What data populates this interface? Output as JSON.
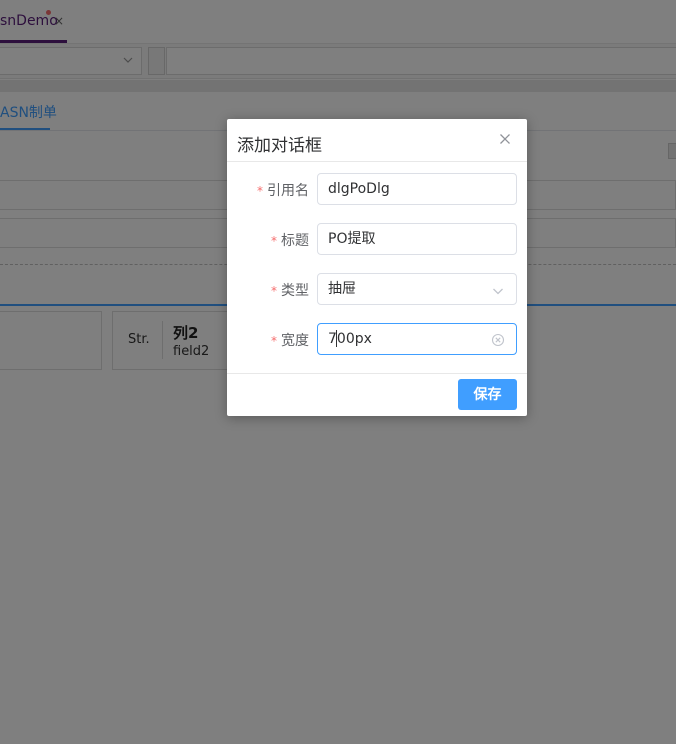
{
  "tabs": {
    "active_label": "snDemo",
    "close_glyph": "×"
  },
  "sub_tabs": {
    "active_label": "ASN制单"
  },
  "card": {
    "type_label": "Str.",
    "title": "列2",
    "field": "field2"
  },
  "dialog": {
    "title": "添加对话框",
    "close_icon": "close-icon",
    "fields": {
      "ref_name": {
        "label": "引用名",
        "value": "dlgPoDlg",
        "required": true
      },
      "title": {
        "label": "标题",
        "value": "PO提取",
        "required": true
      },
      "type": {
        "label": "类型",
        "value": "抽屉",
        "required": true,
        "icon": "chevron-down-icon"
      },
      "width": {
        "label": "宽度",
        "value": "700px",
        "required": true,
        "icon": "clear-circle-icon"
      }
    },
    "required_mark": "*",
    "save_label": "保存"
  },
  "colors": {
    "primary": "#409eff",
    "required": "#f56c6c",
    "tab_active": "#5b1f7a",
    "overlay": "rgba(0,0,0,0.5)"
  }
}
